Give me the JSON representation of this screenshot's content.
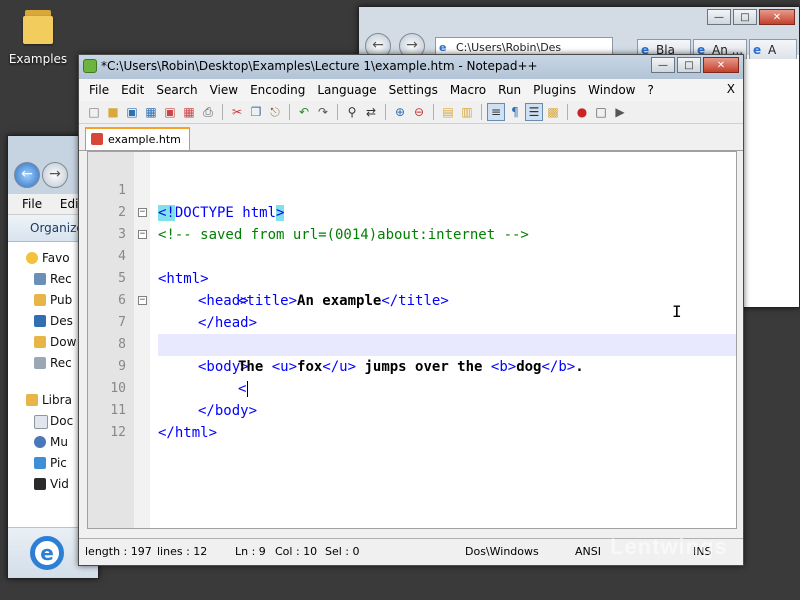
{
  "desktop": {
    "icon_label": "Examples"
  },
  "browser": {
    "address": "C:\\Users\\Robin\\Des",
    "tabs": [
      "Bla",
      "An ...",
      "A"
    ]
  },
  "explorer": {
    "menu": [
      "File",
      "Edit"
    ],
    "organize": "Organize",
    "favorites_label": "Favo",
    "items": [
      "Rec",
      "Pub",
      "Des",
      "Dow",
      "Rec"
    ],
    "libraries_label": "Libra",
    "lib_items": [
      "Doc",
      "Mu",
      "Pic",
      "Vid"
    ]
  },
  "notepad": {
    "title": "*C:\\Users\\Robin\\Desktop\\Examples\\Lecture 1\\example.htm - Notepad++",
    "menu": [
      "File",
      "Edit",
      "Search",
      "View",
      "Encoding",
      "Language",
      "Settings",
      "Macro",
      "Run",
      "Plugins",
      "Window",
      "?"
    ],
    "menu_close": "X",
    "tab_label": "example.htm",
    "line_numbers": [
      "1",
      "2",
      "3",
      "4",
      "5",
      "6",
      "7",
      "8",
      "9",
      "10",
      "11",
      "12"
    ],
    "code": {
      "l1_doctype": "<!",
      "l1_rest": "DOCTYPE html",
      "l1_end": ">",
      "l2": "<!-- saved from url=(0014)about:internet -->",
      "l3": "<html>",
      "l4": "<head>",
      "l5_open": "<title>",
      "l5_text": "An example",
      "l5_close": "</title>",
      "l6": "</head>",
      "l7": "<body>",
      "l8_a": "The ",
      "l8_u_open": "<u>",
      "l8_fox": "fox",
      "l8_u_close": "</u>",
      "l8_mid": " jumps over the ",
      "l8_b_open": "<b>",
      "l8_dog": "dog",
      "l8_b_close": "</b>",
      "l8_end": ".",
      "l9": "<",
      "l10": "</body>",
      "l11": "</html>"
    },
    "status": {
      "length": "length : 197",
      "lines": "lines : 12",
      "ln": "Ln : 9",
      "col": "Col : 10",
      "sel": "Sel : 0",
      "eol": "Dos\\Windows",
      "encoding": "ANSI",
      "mode": "INS"
    }
  },
  "watermark": "Lentwings"
}
